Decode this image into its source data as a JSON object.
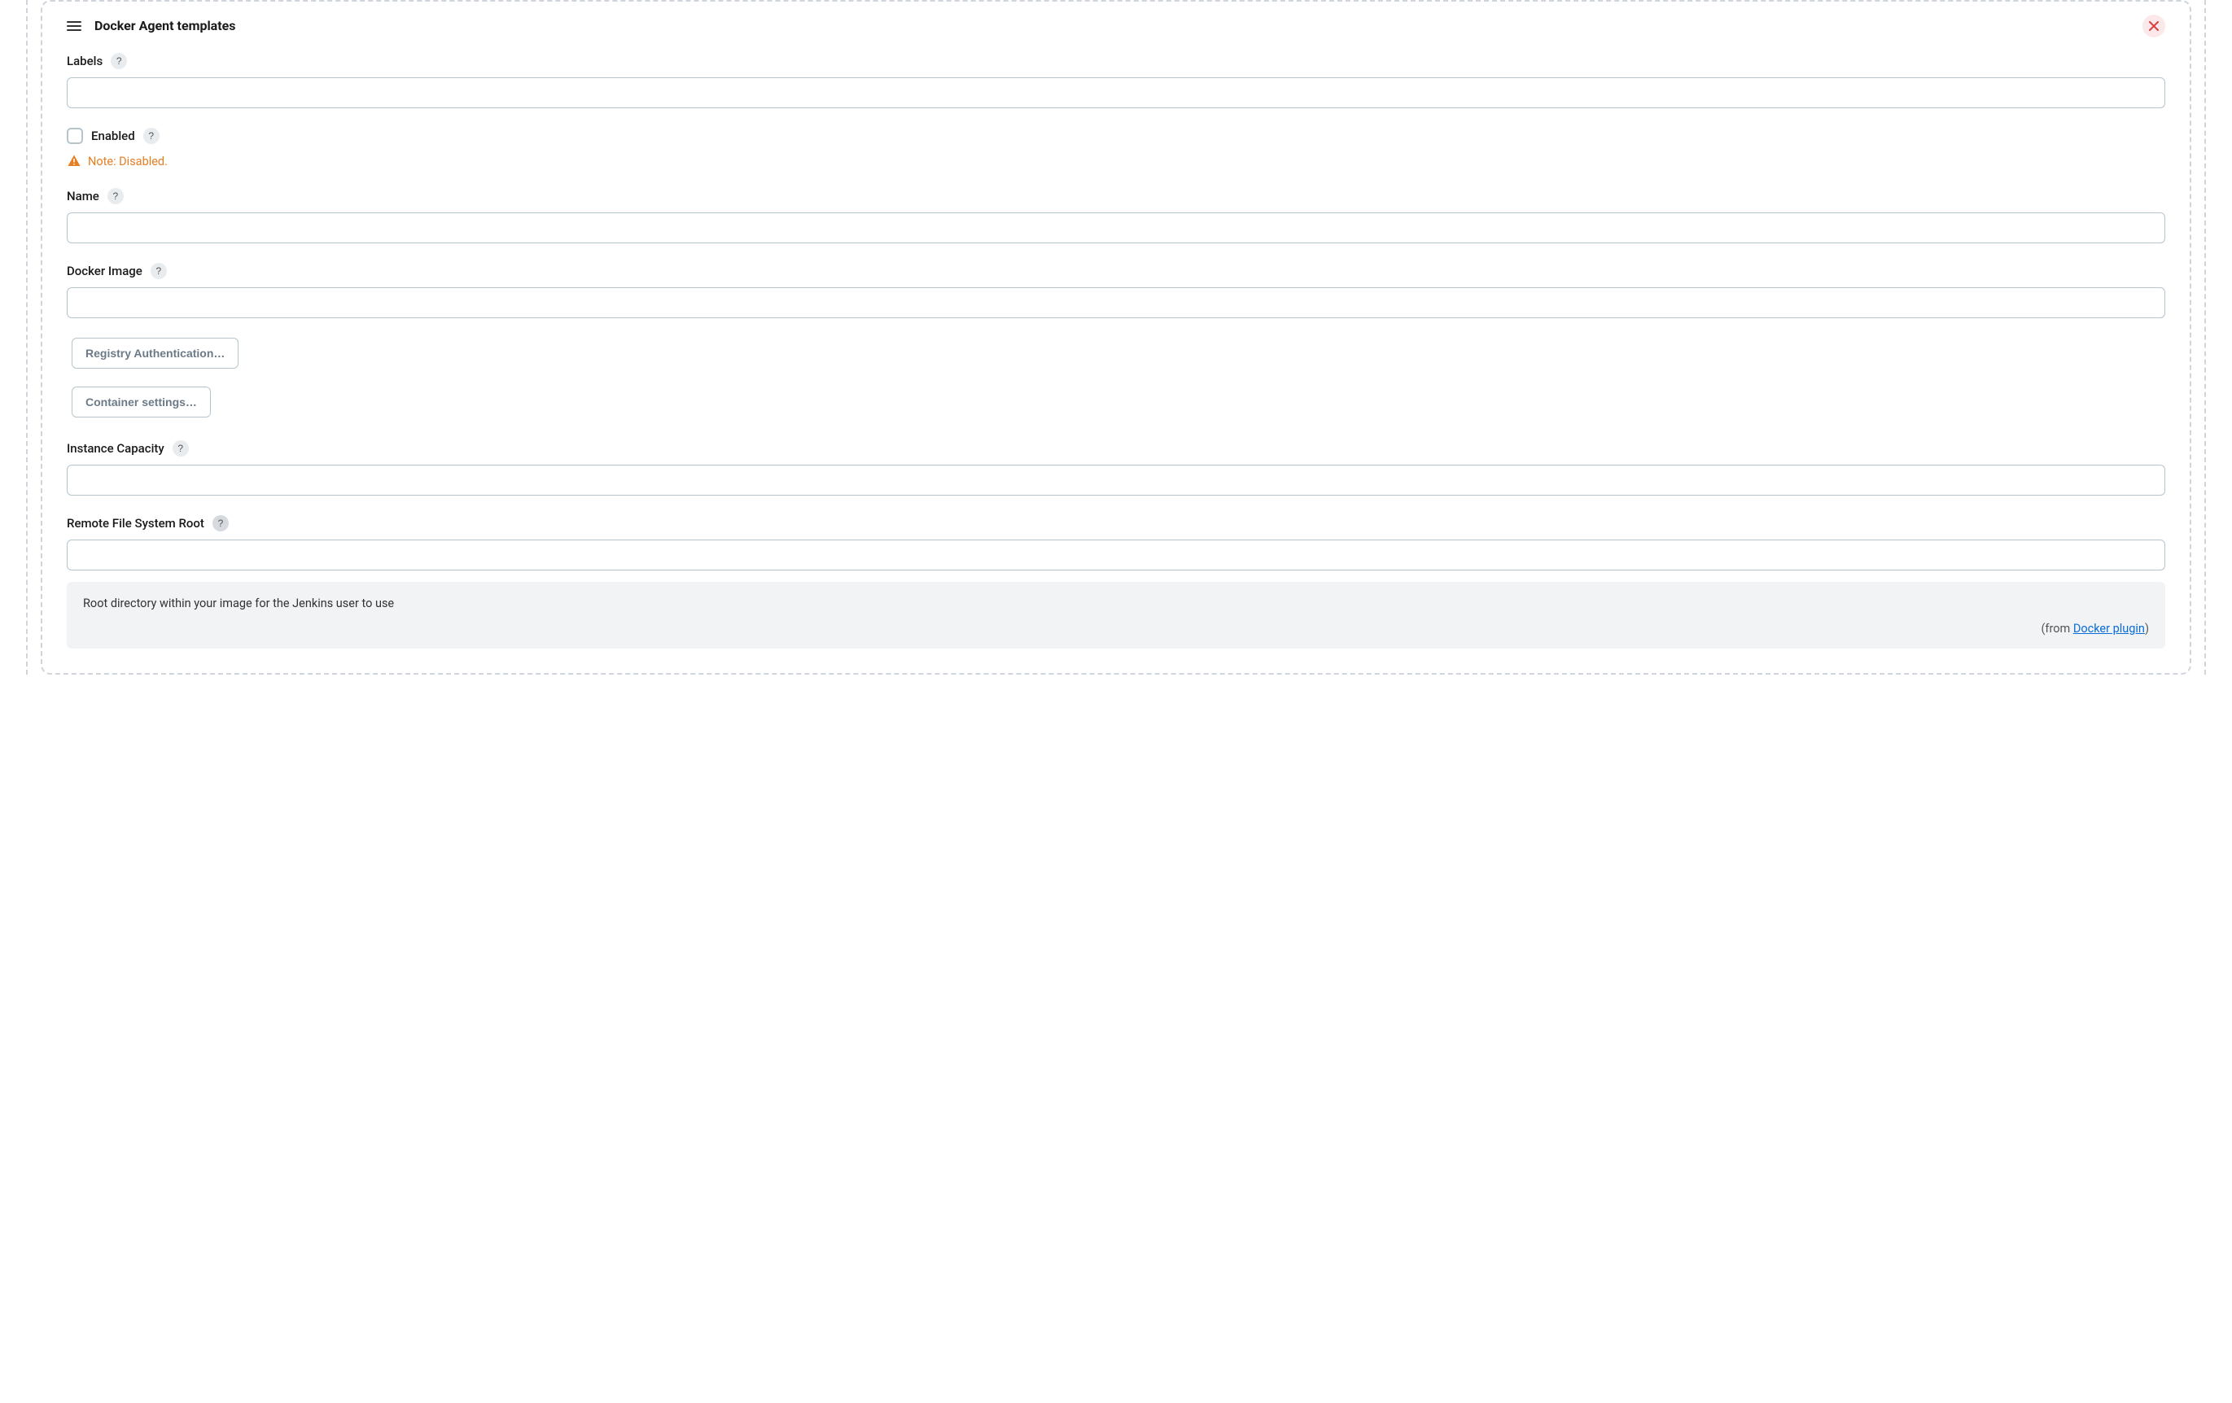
{
  "panel": {
    "title": "Docker Agent templates"
  },
  "fields": {
    "labels": {
      "label": "Labels",
      "value": ""
    },
    "enabled": {
      "label": "Enabled",
      "checked": false,
      "warning": "Note: Disabled."
    },
    "name": {
      "label": "Name",
      "value": ""
    },
    "docker_image": {
      "label": "Docker Image",
      "value": ""
    },
    "registry_auth_btn": "Registry Authentication…",
    "container_settings_btn": "Container settings…",
    "instance_capacity": {
      "label": "Instance Capacity",
      "value": ""
    },
    "remote_fs_root": {
      "label": "Remote File System Root",
      "value": "",
      "help_text": "Root directory within your image for the Jenkins user to use",
      "help_from_prefix": "(from ",
      "help_from_link": "Docker plugin",
      "help_from_suffix": ")"
    }
  },
  "glyphs": {
    "help": "?"
  }
}
